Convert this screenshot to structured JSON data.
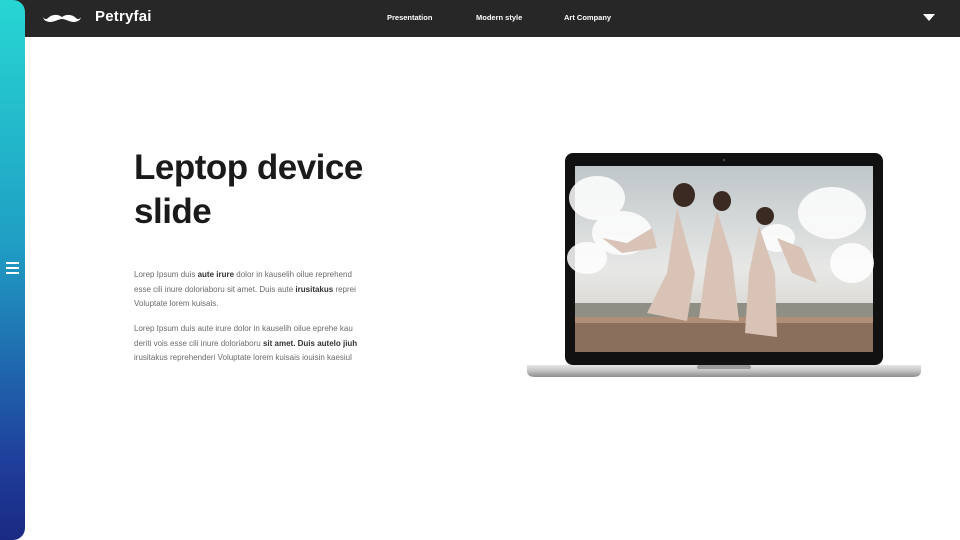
{
  "brand": {
    "name": "Petryfai",
    "logo_icon": "mustache-icon"
  },
  "nav": {
    "items": [
      {
        "label": "Presentation"
      },
      {
        "label": "Modern style"
      },
      {
        "label": "Art Company"
      }
    ],
    "dropdown_icon": "caret-down-icon"
  },
  "sidebar": {
    "menu_icon": "hamburger-icon"
  },
  "slide": {
    "title_line1": "Leptop device",
    "title_line2": "slide",
    "paragraph1": {
      "l1_a": "Lorep  Ipsum duis ",
      "l1_b": "aute irure",
      "l1_c": " dolor in kauselih oilue reprehend",
      "l2_a": "esse cili inure doloriaboru sit amet. Duis aute ",
      "l2_b": "irusitakus",
      "l2_c": " reprei",
      "l3": "Voluptate lorem kuisais."
    },
    "paragraph2": {
      "l1": "Lorep  Ipsum duis aute irure dolor in kauselih oilue eprehe kau",
      "l2_a": "deriti vois esse cili inure doloriaboru ",
      "l2_b": "sit amet. Duis autelo jiuh",
      "l3": "irusitakus reprehenderi Voluptate lorem kuisais iouisin kaesiul"
    }
  },
  "device": {
    "type": "laptop",
    "screen_content": "three women in flowing dresses on a wall under cloudy sky"
  },
  "colors": {
    "topbar": "#272727",
    "sidebar_top": "#27d6d3",
    "sidebar_bottom": "#1a2a82",
    "title": "#1a1a1a",
    "body_text": "#6b6b6b"
  }
}
